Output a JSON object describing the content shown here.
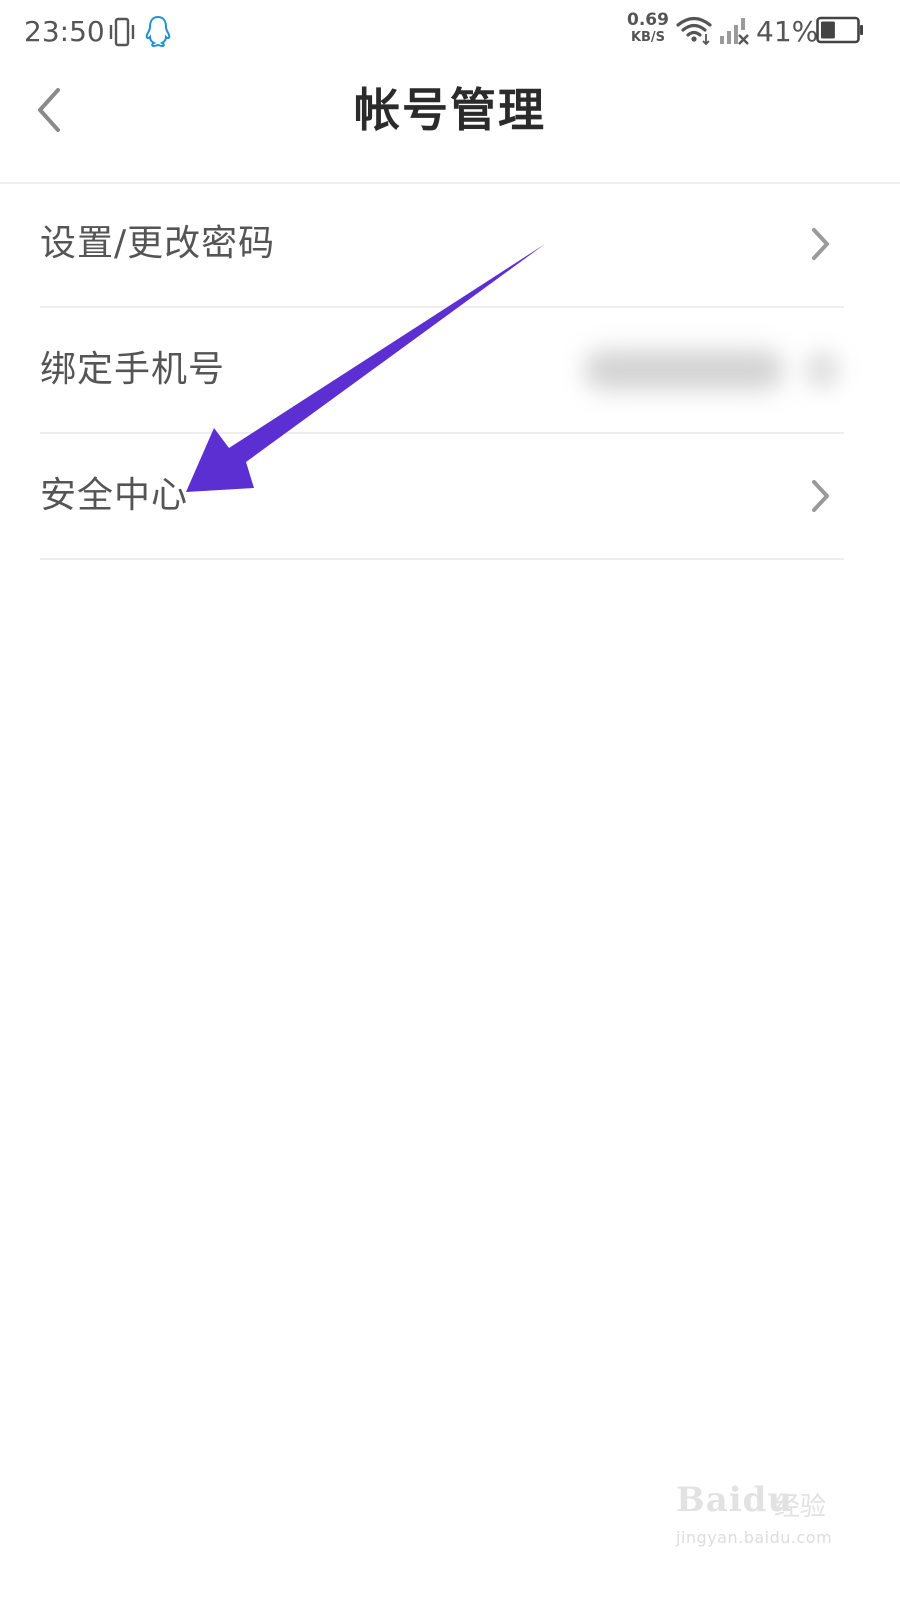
{
  "status_bar": {
    "time": "23:50",
    "net_speed_value": "0.69",
    "net_speed_unit": "KB/S",
    "battery_percent": "41%",
    "battery_level": 0.41,
    "icons": [
      "vibrate-icon",
      "qq-icon",
      "wifi-icon",
      "signal-icon",
      "battery-icon"
    ]
  },
  "header": {
    "title": "帐号管理"
  },
  "menu": {
    "items": [
      {
        "label": "设置/更改密码",
        "has_chevron": true
      },
      {
        "label": "绑定手机号",
        "value_obscured": true
      },
      {
        "label": "安全中心",
        "has_chevron": true
      }
    ]
  },
  "annotation": {
    "arrow_color": "#5b2fd1",
    "target": "安全中心"
  },
  "watermark": {
    "brand": "Baidu",
    "sub": "经验",
    "url": "jingyan.baidu.com"
  },
  "colors": {
    "text_primary": "#2b2b2b",
    "text_secondary": "#555555",
    "divider": "#eeeeee",
    "chevron": "#9a9a9a",
    "qq_blue": "#1e90d6"
  }
}
